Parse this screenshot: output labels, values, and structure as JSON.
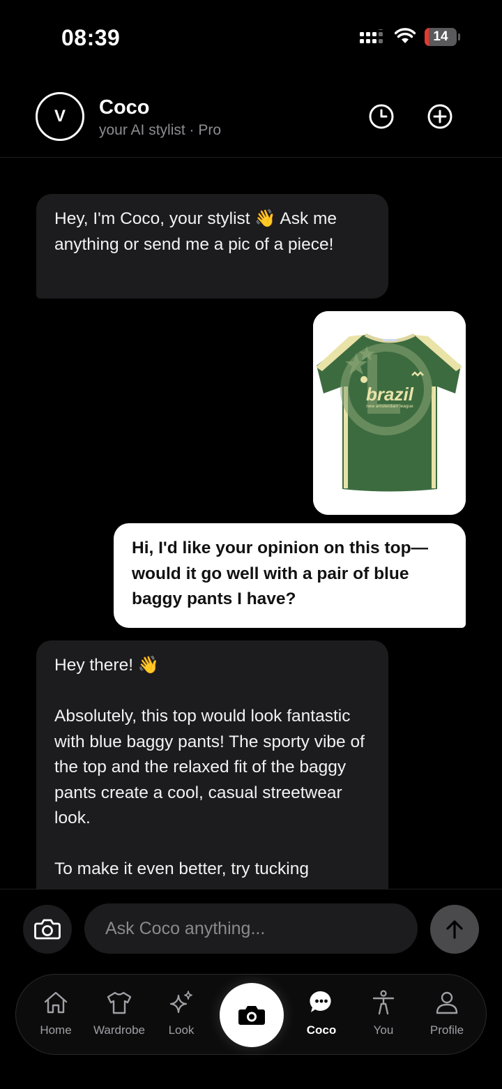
{
  "status_bar": {
    "time": "08:39",
    "battery": "14",
    "battery_level": 0.14
  },
  "header": {
    "avatar_letter": "V",
    "name": "Coco",
    "subtitle": "your AI stylist · Pro"
  },
  "messages": {
    "m1": "Hey, I'm Coco, your stylist 👋 Ask me anything or send me a pic of a piece!",
    "image": {
      "brand_text": "brazil",
      "caption_text": "new amsterdam league"
    },
    "m3": "Hi, I'd like your opinion on this top—would it go well with a pair of blue baggy pants I have?",
    "m4": {
      "p1": "Hey there! 👋",
      "p2": "Absolutely, this top would look fantastic with blue baggy pants! The sporty vibe of the top and the relaxed fit of the baggy pants create a cool, casual streetwear look.",
      "p3": "To make it even better, try tucking"
    }
  },
  "composer": {
    "placeholder": "Ask Coco anything..."
  },
  "tabs": {
    "home": "Home",
    "wardrobe": "Wardrobe",
    "look": "Look",
    "coco": "Coco",
    "you": "You",
    "profile": "Profile"
  },
  "colors": {
    "background": "#000000",
    "ai_bubble": "#1c1c1e",
    "user_bubble": "#ffffff",
    "shirt_green": "#3d6b40",
    "shirt_cream": "#e9e3a8",
    "battery_red": "#e5392f"
  }
}
